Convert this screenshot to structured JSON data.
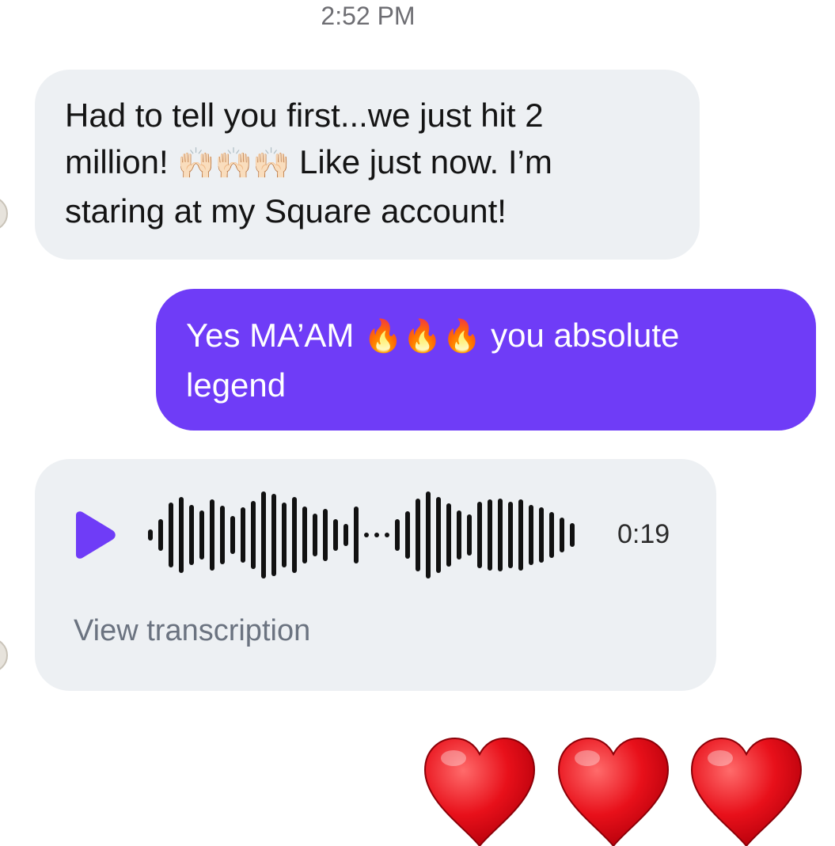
{
  "conversation": {
    "timestamp": "2:52 PM",
    "messages": [
      {
        "direction": "incoming",
        "text_line1": "Had to tell you first...we just hit 2",
        "text_line2_start": "million!",
        "text_line2_emoji": "🙌🏻🙌🏻🙌🏻",
        "text_line2_end": "Like just now. I’m",
        "text_line3": "staring at my Square account!"
      },
      {
        "direction": "outgoing",
        "text_start": "Yes MA’AM",
        "text_emoji": "🔥🔥🔥",
        "text_end": "you absolute legend",
        "bubble_color": "#6f3cf7"
      },
      {
        "direction": "incoming",
        "type": "voice",
        "play_icon": "play-icon",
        "duration": "0:19",
        "view_transcription_label": "View transcription",
        "accent_color": "#6f3cf7"
      },
      {
        "direction": "outgoing",
        "type": "reaction",
        "emoji": "❤️❤️❤️",
        "icon": "heart-icon"
      }
    ]
  }
}
